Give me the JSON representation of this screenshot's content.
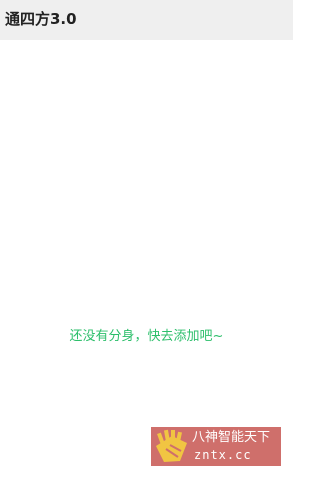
{
  "app": {
    "title": "通四方3.0"
  },
  "main": {
    "empty_message": "还没有分身，快去添加吧~"
  },
  "watermark": {
    "line1": "八神智能天下",
    "line2": "zntx.cc"
  },
  "colors": {
    "title_bar_bg": "#efefef",
    "accent_green": "#2dbf6b",
    "watermark_bg": "#cf6f6b",
    "logo_yellow": "#f1c542"
  }
}
